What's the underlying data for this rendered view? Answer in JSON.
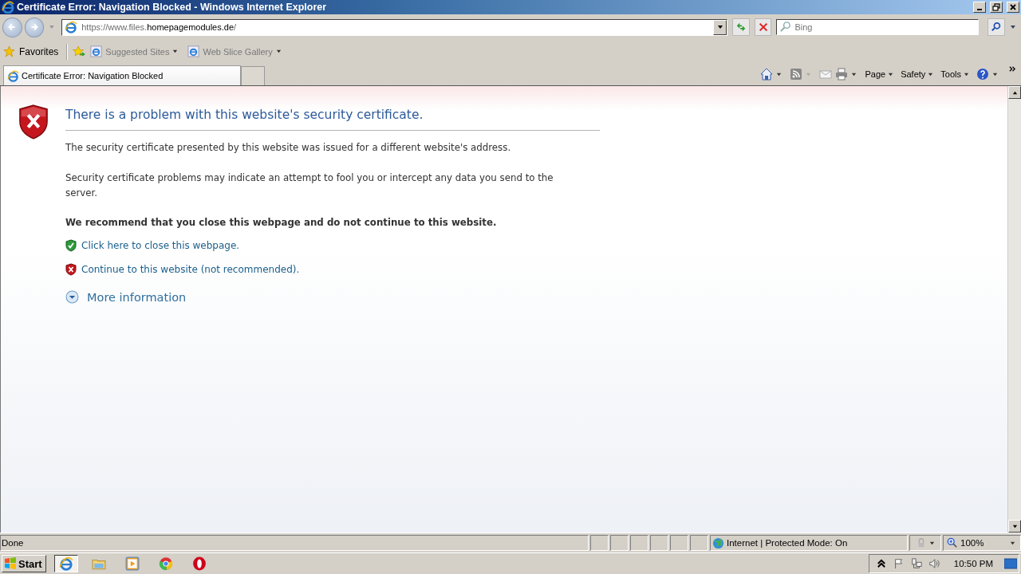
{
  "window": {
    "title": "Certificate Error: Navigation Blocked - Windows Internet Explorer"
  },
  "address_bar": {
    "url_prefix": "https://www.files.",
    "url_domain": "homepagemodules.de",
    "url_suffix": "/"
  },
  "search": {
    "placeholder": "Bing"
  },
  "favorites_bar": {
    "favorites": "Favorites",
    "links": [
      {
        "label": "Suggested Sites"
      },
      {
        "label": "Web Slice Gallery"
      }
    ]
  },
  "tabs": [
    {
      "label": "Certificate Error: Navigation Blocked",
      "selected": true
    }
  ],
  "command_bar": [
    "Page",
    "Safety",
    "Tools"
  ],
  "page": {
    "heading": "There is a problem with this website's security certificate.",
    "paragraphs": [
      "The security certificate presented by this website was issued for a different website's address.",
      "Security certificate problems may indicate an attempt to fool you or intercept any data you send to the server."
    ],
    "recommendation": "We recommend that you close this webpage and do not continue to this website.",
    "actions": [
      {
        "kind": "safe",
        "label": "Click here to close this webpage."
      },
      {
        "kind": "unsafe",
        "label": "Continue to this website (not recommended)."
      }
    ],
    "more_info": "More information"
  },
  "status_bar": {
    "status": "Done",
    "zone": "Internet | Protected Mode: On",
    "zoom": "100%"
  },
  "taskbar": {
    "start": "Start",
    "clock": "10:50 PM"
  }
}
